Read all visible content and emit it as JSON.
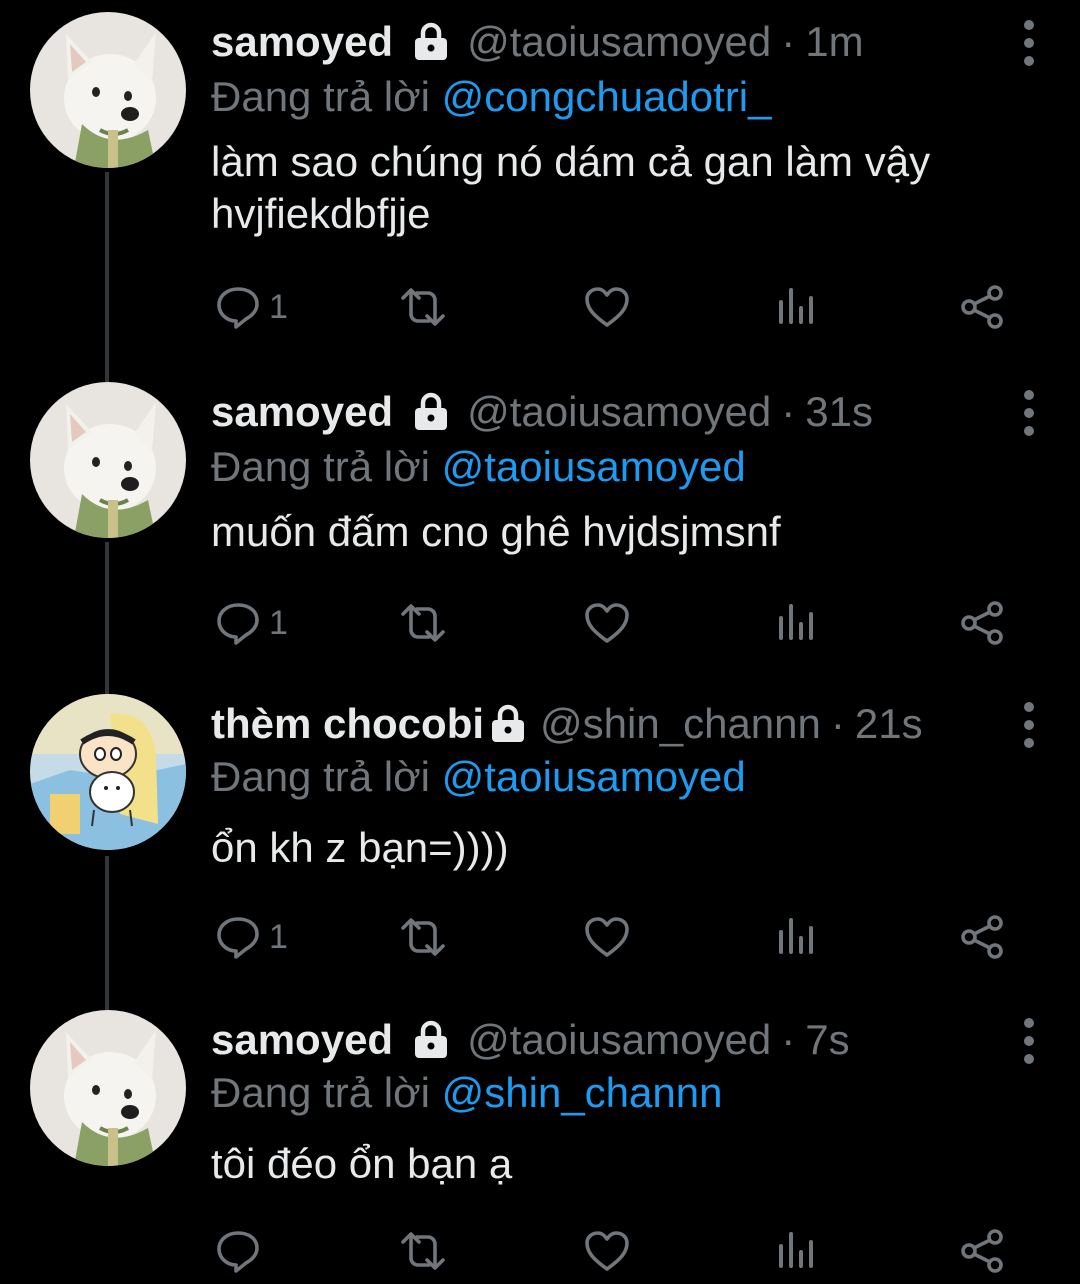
{
  "reply_prefix": "Đang trả lời",
  "colors": {
    "background": "#000000",
    "text": "#e7e9ea",
    "muted": "#71767b",
    "accent": "#1d9bf0"
  },
  "tweets": [
    {
      "display_name": "samoyed",
      "handle": "@taoiusamoyed",
      "separator": "·",
      "time": "1m",
      "reply_to": "@congchuadotri_",
      "text_lines": [
        "làm sao chúng nó dám cả gan làm vậy",
        "hvjfiekdbfjje"
      ],
      "reply_count": "1",
      "avatar": "samoyed-dog-avatar",
      "protected": true
    },
    {
      "display_name": "samoyed",
      "handle": "@taoiusamoyed",
      "separator": "·",
      "time": "31s",
      "reply_to": "@taoiusamoyed",
      "text_lines": [
        "muốn đấm cno ghê hvjdsjmsnf"
      ],
      "reply_count": "1",
      "avatar": "samoyed-dog-avatar",
      "protected": true
    },
    {
      "display_name": "thèm chocobi",
      "handle": "@shin_channn",
      "separator": "·",
      "time": "21s",
      "reply_to": "@taoiusamoyed",
      "text_lines": [
        "ổn kh z bạn=))))"
      ],
      "reply_count": "1",
      "avatar": "shin-chan-cartoon-avatar",
      "protected": true
    },
    {
      "display_name": "samoyed",
      "handle": "@taoiusamoyed",
      "separator": "·",
      "time": "7s",
      "reply_to": "@shin_channn",
      "text_lines": [
        "tôi đéo ổn bạn ạ"
      ],
      "reply_count": "",
      "avatar": "samoyed-dog-avatar",
      "protected": true
    }
  ]
}
